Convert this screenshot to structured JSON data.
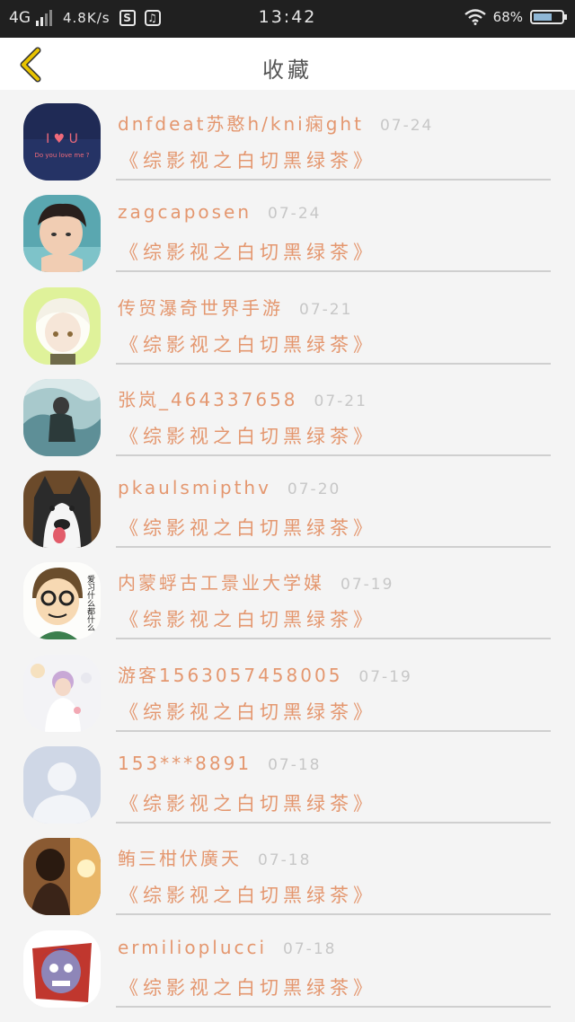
{
  "status_bar": {
    "network": "4G",
    "speed": "4.8K/s",
    "time": "13:42",
    "battery": "68%",
    "battery_level": 0.68
  },
  "header": {
    "title": "收藏"
  },
  "favorites": [
    {
      "user": "dnfdeat苏憨h/kni痫ght",
      "date": "07-24",
      "book": "《综影视之白切黑绿茶》",
      "avatar": "avatar-heart"
    },
    {
      "user": "zagcaposen",
      "date": "07-24",
      "book": "《综影视之白切黑绿茶》",
      "avatar": "avatar-boy"
    },
    {
      "user": "传贸瀑奇世界手游",
      "date": "07-21",
      "book": "《综影视之白切黑绿茶》",
      "avatar": "avatar-anime"
    },
    {
      "user": "张岚_464337658",
      "date": "07-21",
      "book": "《综影视之白切黑绿茶》",
      "avatar": "avatar-water"
    },
    {
      "user": "pkaulsmipthv",
      "date": "07-20",
      "book": "《综影视之白切黑绿茶》",
      "avatar": "avatar-husky"
    },
    {
      "user": "内蒙蜉古工景业大学媒",
      "date": "07-19",
      "book": "《综影视之白切黑绿茶》",
      "avatar": "avatar-cartoon"
    },
    {
      "user": "游客1563057458005",
      "date": "07-19",
      "book": "《综影视之白切黑绿茶》",
      "avatar": "avatar-snow"
    },
    {
      "user": "153***8891",
      "date": "07-18",
      "book": "《综影视之白切黑绿茶》",
      "avatar": "avatar-default"
    },
    {
      "user": "鲔三柑伏廣天",
      "date": "07-18",
      "book": "《综影视之白切黑绿茶》",
      "avatar": "avatar-sunset"
    },
    {
      "user": "ermilioplucci",
      "date": "07-18",
      "book": "《综影视之白切黑绿茶》",
      "avatar": "avatar-monster"
    }
  ],
  "avatar_text": {
    "heart_line1": "I ♥ U",
    "heart_line2": "Do you love me ?",
    "cartoon_side": "爱习什么都什么"
  },
  "colors": {
    "accent": "#e4976f",
    "date": "#c7c7c7",
    "back_arrow": "#e8c300"
  }
}
